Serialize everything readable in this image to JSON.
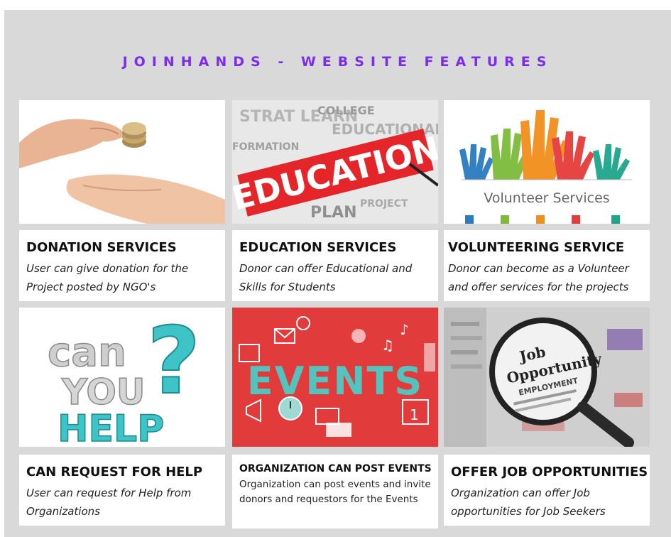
{
  "header": {
    "title": "JOINHANDS - WEBSITE FEATURES"
  },
  "features": [
    {
      "title": "DONATION SERVICES",
      "description": "User can give donation for the Project posted by NGO's",
      "image": "hand-coins-image"
    },
    {
      "title": "EDUCATION SERVICES",
      "description": "Donor can offer Educational and Skills for Students",
      "image": "education-word-image",
      "image_text": "EDUCATION"
    },
    {
      "title": "VOLUNTEERING SERVICE",
      "description": "Donor can become as a Volunteer and offer services for the  projects",
      "image": "raised-hands-image",
      "image_text": "Volunteer Services"
    },
    {
      "title": "CAN REQUEST FOR HELP",
      "description": "User can request for Help from Organizations",
      "image": "can-you-help-image",
      "image_text": [
        "can",
        "YOU",
        "HELP"
      ]
    },
    {
      "title": "ORGANIZATION CAN POST EVENTS",
      "description": "Organization can post events and invite donors and requestors for the Events",
      "image": "events-image",
      "image_text": "EVENTS"
    },
    {
      "title": "OFFER JOB OPPORTUNITIES",
      "description": "Organization can offer Job opportunities for Job Seekers",
      "image": "job-opportunity-image",
      "image_text": [
        "Job",
        "Opportunity",
        "EMPLOYMENT"
      ]
    }
  ],
  "colors": {
    "title": "#7c2cf0",
    "panel": "#d9d9d9",
    "events_red": "#e23b3b",
    "teal": "#3bb8b5"
  }
}
